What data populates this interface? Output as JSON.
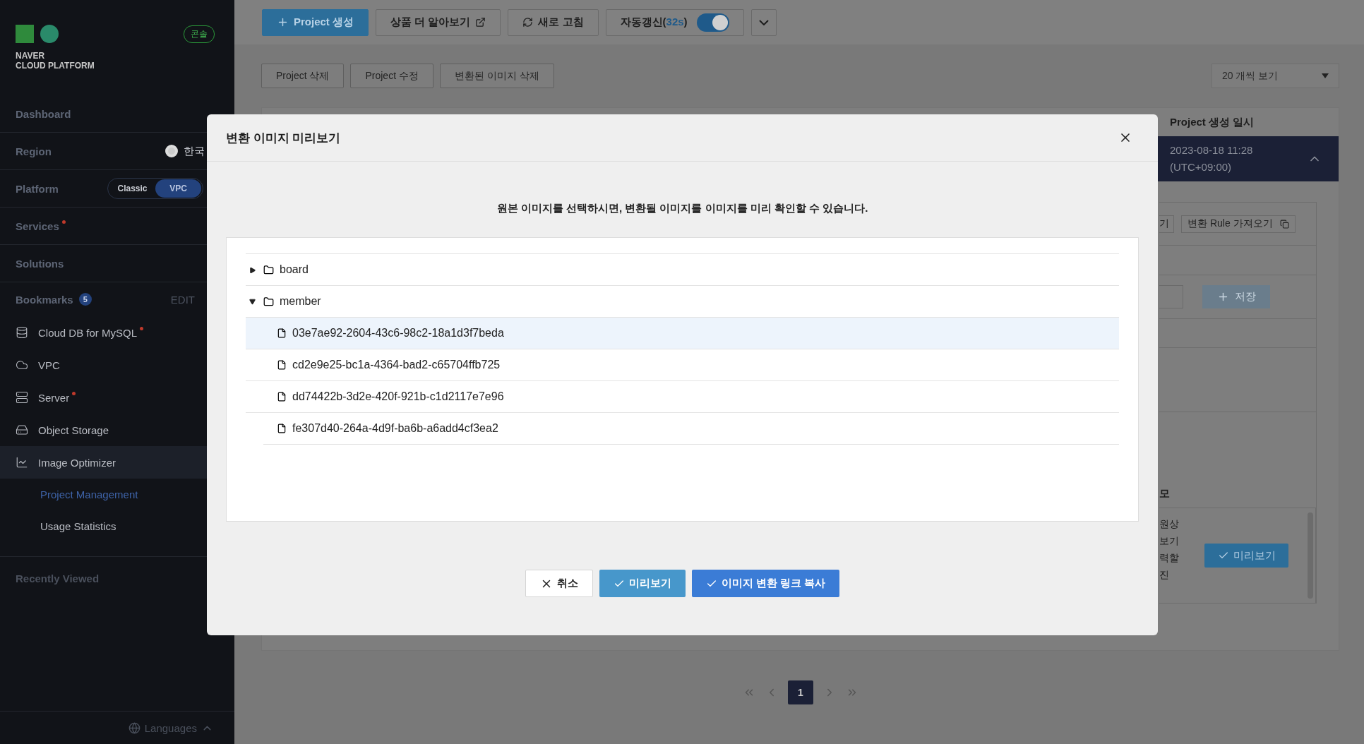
{
  "sidebar": {
    "logo": {
      "line1": "NAVER",
      "line2": "CLOUD PLATFORM"
    },
    "console_badge": "콘솔",
    "sections": [
      {
        "kind": "plain",
        "label": "Dashboard"
      },
      {
        "kind": "region",
        "label": "Region",
        "value": "한국"
      },
      {
        "kind": "platform",
        "label": "Platform",
        "options": [
          {
            "label": "Classic",
            "selected": false
          },
          {
            "label": "VPC",
            "selected": true
          }
        ]
      },
      {
        "kind": "plain",
        "label": "Services",
        "dot": true
      },
      {
        "kind": "plain",
        "label": "Solutions"
      }
    ],
    "bookmarks": {
      "label": "Bookmarks",
      "count": "5",
      "edit": "EDIT",
      "items": [
        {
          "label": "Cloud DB for MySQL",
          "dot": true,
          "expanded": false
        },
        {
          "label": "VPC",
          "dot": false,
          "expanded": false
        },
        {
          "label": "Server",
          "dot": true,
          "expanded": false
        },
        {
          "label": "Object Storage",
          "dot": false,
          "expanded": false
        },
        {
          "label": "Image Optimizer",
          "dot": false,
          "expanded": true,
          "children": [
            {
              "label": "Project Management",
              "selected": true
            },
            {
              "label": "Usage Statistics",
              "selected": false
            }
          ]
        }
      ]
    },
    "recently_viewed": "Recently Viewed",
    "languages": "Languages"
  },
  "toolbar": {
    "create": "Project 생성",
    "learn_more": "상품 더 알아보기",
    "refresh": "새로 고침",
    "auto_refresh": {
      "prefix": "자동갱신(",
      "count": "32s",
      "suffix": ")",
      "on": true
    }
  },
  "actions": [
    "Project 삭제",
    "Project 수정",
    "변환된 이미지 삭제"
  ],
  "page_size": "20 개씩 보기",
  "table": {
    "column": "Project 생성 일시",
    "selected_row": {
      "date": "2023-08-18 11:28",
      "zone": "(UTC+09:00)"
    }
  },
  "detail": {
    "partial_button": "기",
    "rule_button": "변환 Rule 가져오기",
    "save_button": "저장",
    "memo_heading": "모",
    "memo_lines": [
      "원상",
      "보기",
      "력할",
      "진"
    ],
    "preview_button": "미리보기"
  },
  "pagination": {
    "pages": [
      {
        "label": "1",
        "selected": true
      }
    ]
  },
  "modal": {
    "title": "변환 이미지 미리보기",
    "description": "원본 이미지를 선택하시면, 변환될 이미지를 이미지를 미리 확인할 수 있습니다.",
    "tree": [
      {
        "kind": "folder",
        "label": "board",
        "expanded": false
      },
      {
        "kind": "folder",
        "label": "member",
        "expanded": true,
        "children": [
          {
            "kind": "file",
            "label": "03e7ae92-2604-43c6-98c2-18a1d3f7beda",
            "selected": true
          },
          {
            "kind": "file",
            "label": "cd2e9e25-bc1a-4364-bad2-c65704ffb725",
            "selected": false
          },
          {
            "kind": "file",
            "label": "dd74422b-3d2e-420f-921b-c1d2117e7e96",
            "selected": false
          },
          {
            "kind": "file",
            "label": "fe307d40-264a-4d9f-ba6b-a6add4cf3ea2",
            "selected": false
          }
        ]
      }
    ],
    "buttons": [
      {
        "kind": "cancel",
        "label": "취소"
      },
      {
        "kind": "preview",
        "label": "미리보기"
      },
      {
        "kind": "copy",
        "label": "이미지 변환 링크 복사"
      }
    ]
  }
}
